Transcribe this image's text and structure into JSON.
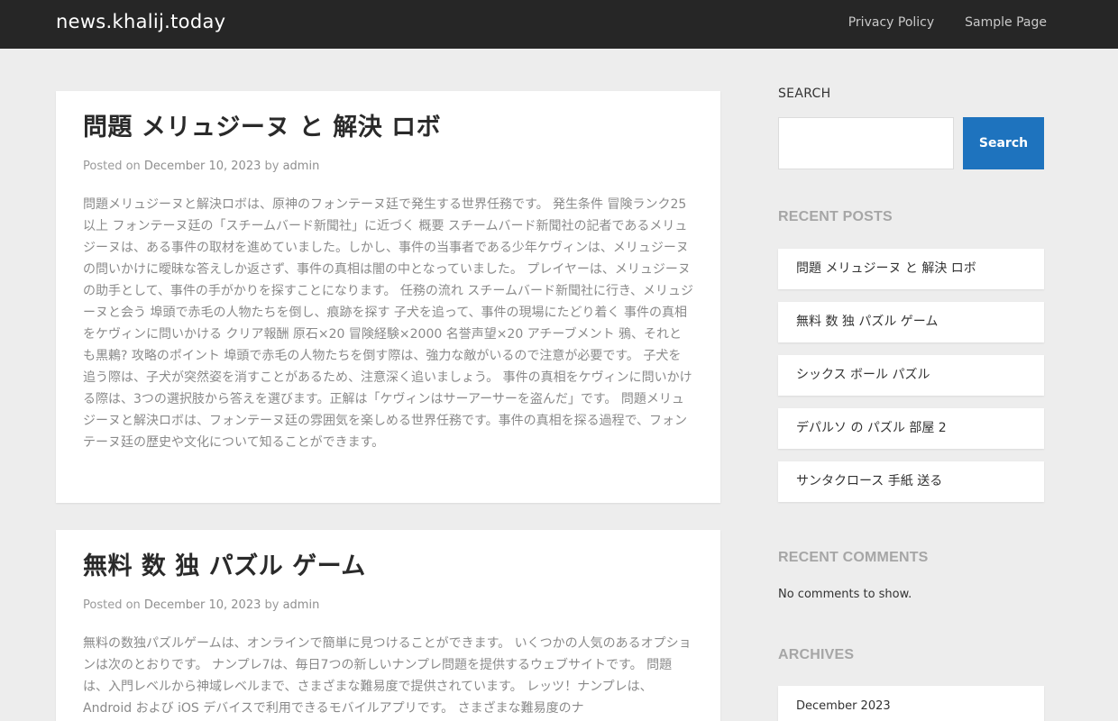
{
  "site": {
    "title": "news.khalij.today"
  },
  "nav": {
    "items": [
      "Privacy Policy",
      "Sample Page"
    ]
  },
  "posts": [
    {
      "title": "問題 メリュジーヌ と 解決 ロボ",
      "meta": {
        "posted_on": "Posted on",
        "date": "December 10, 2023",
        "by": "by",
        "author": "admin"
      },
      "excerpt": "問題メリュジーヌと解決ロボは、原神のフォンテーヌ廷で発生する世界任務です。 発生条件 冒険ランク25以上 フォンテーヌ廷の「スチームバード新聞社」に近づく 概要 スチームバード新聞社の記者であるメリュジーヌは、ある事件の取材を進めていました。しかし、事件の当事者である少年ケヴィンは、メリュジーヌの問いかけに曖昧な答えしか返さず、事件の真相は闇の中となっていました。 プレイヤーは、メリュジーヌの助手として、事件の手がかりを探すことになります。 任務の流れ スチームバード新聞社に行き、メリュジーヌと会う 埠頭で赤毛の人物たちを倒し、痕跡を探す 子犬を追って、事件の現場にたどり着く 事件の真相をケヴィンに問いかける クリア報酬 原石×20 冒険経験×2000 名誉声望×20 アチーブメント 鴉、それとも黒鶫? 攻略のポイント 埠頭で赤毛の人物たちを倒す際は、強力な敵がいるので注意が必要です。 子犬を追う際は、子犬が突然姿を消すことがあるため、注意深く追いましょう。 事件の真相をケヴィンに問いかける際は、3つの選択肢から答えを選びます。正解は「ケヴィンはサーアーサーを盗んだ」です。 問題メリュジーヌと解決ロボは、フォンテーヌ廷の雰囲気を楽しめる世界任務です。事件の真相を探る過程で、フォンテーヌ廷の歴史や文化について知ることができます。"
    },
    {
      "title": "無料 数 独 パズル ゲーム",
      "meta": {
        "posted_on": "Posted on",
        "date": "December 10, 2023",
        "by": "by",
        "author": "admin"
      },
      "excerpt": "無料の数独パズルゲームは、オンラインで簡単に見つけることができます。 いくつかの人気のあるオプションは次のとおりです。 ナンプレ7は、毎日7つの新しいナンプレ問題を提供するウェブサイトです。 問題は、入門レベルから神域レベルまで、さまざまな難易度で提供されています。  レッツ！ナンプレは、Android および iOS デバイスで利用できるモバイルアプリです。 さまざまな難易度のナ"
    }
  ],
  "sidebar": {
    "search": {
      "label": "SEARCH",
      "placeholder": "",
      "button": "Search"
    },
    "recent_posts": {
      "heading": "RECENT POSTS",
      "items": [
        "問題 メリュジーヌ と 解決 ロボ",
        "無料 数 独 パズル ゲーム",
        "シックス ボール パズル",
        "デパルソ の パズル 部屋 2",
        "サンタクロース 手紙 送る"
      ]
    },
    "recent_comments": {
      "heading": "RECENT COMMENTS",
      "empty": "No comments to show."
    },
    "archives": {
      "heading": "ARCHIVES",
      "items": [
        "December 2023"
      ]
    }
  },
  "colors": {
    "topbar": "#262626",
    "accent": "#1e73be",
    "page_bg": "#ededed"
  }
}
